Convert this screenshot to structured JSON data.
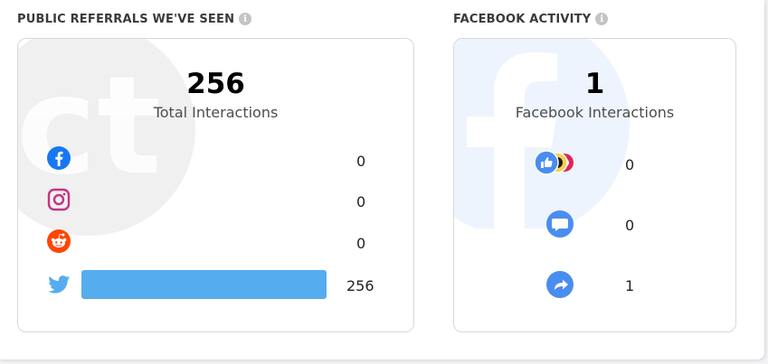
{
  "referrals": {
    "title": "PUBLIC REFERRALS WE'VE SEEN",
    "watermark": "ct",
    "total": "256",
    "total_label": "Total Interactions",
    "max_value": 256,
    "rows": [
      {
        "platform": "facebook-icon",
        "value": "0",
        "amount": 0
      },
      {
        "platform": "instagram-icon",
        "value": "0",
        "amount": 0
      },
      {
        "platform": "reddit-icon",
        "value": "0",
        "amount": 0
      },
      {
        "platform": "twitter-icon",
        "value": "256",
        "amount": 256
      }
    ]
  },
  "facebook": {
    "title": "FACEBOOK ACTIVITY",
    "total": "1",
    "total_label": "Facebook Interactions",
    "rows": [
      {
        "icon": "reactions-icon",
        "value": "0"
      },
      {
        "icon": "comment-icon",
        "value": "0"
      },
      {
        "icon": "share-icon",
        "value": "1"
      }
    ]
  },
  "colors": {
    "facebook": "#1877f2",
    "instagram": "#c13584",
    "reddit": "#ff4500",
    "twitter": "#55acee",
    "fb_action": "#4a8df0"
  }
}
